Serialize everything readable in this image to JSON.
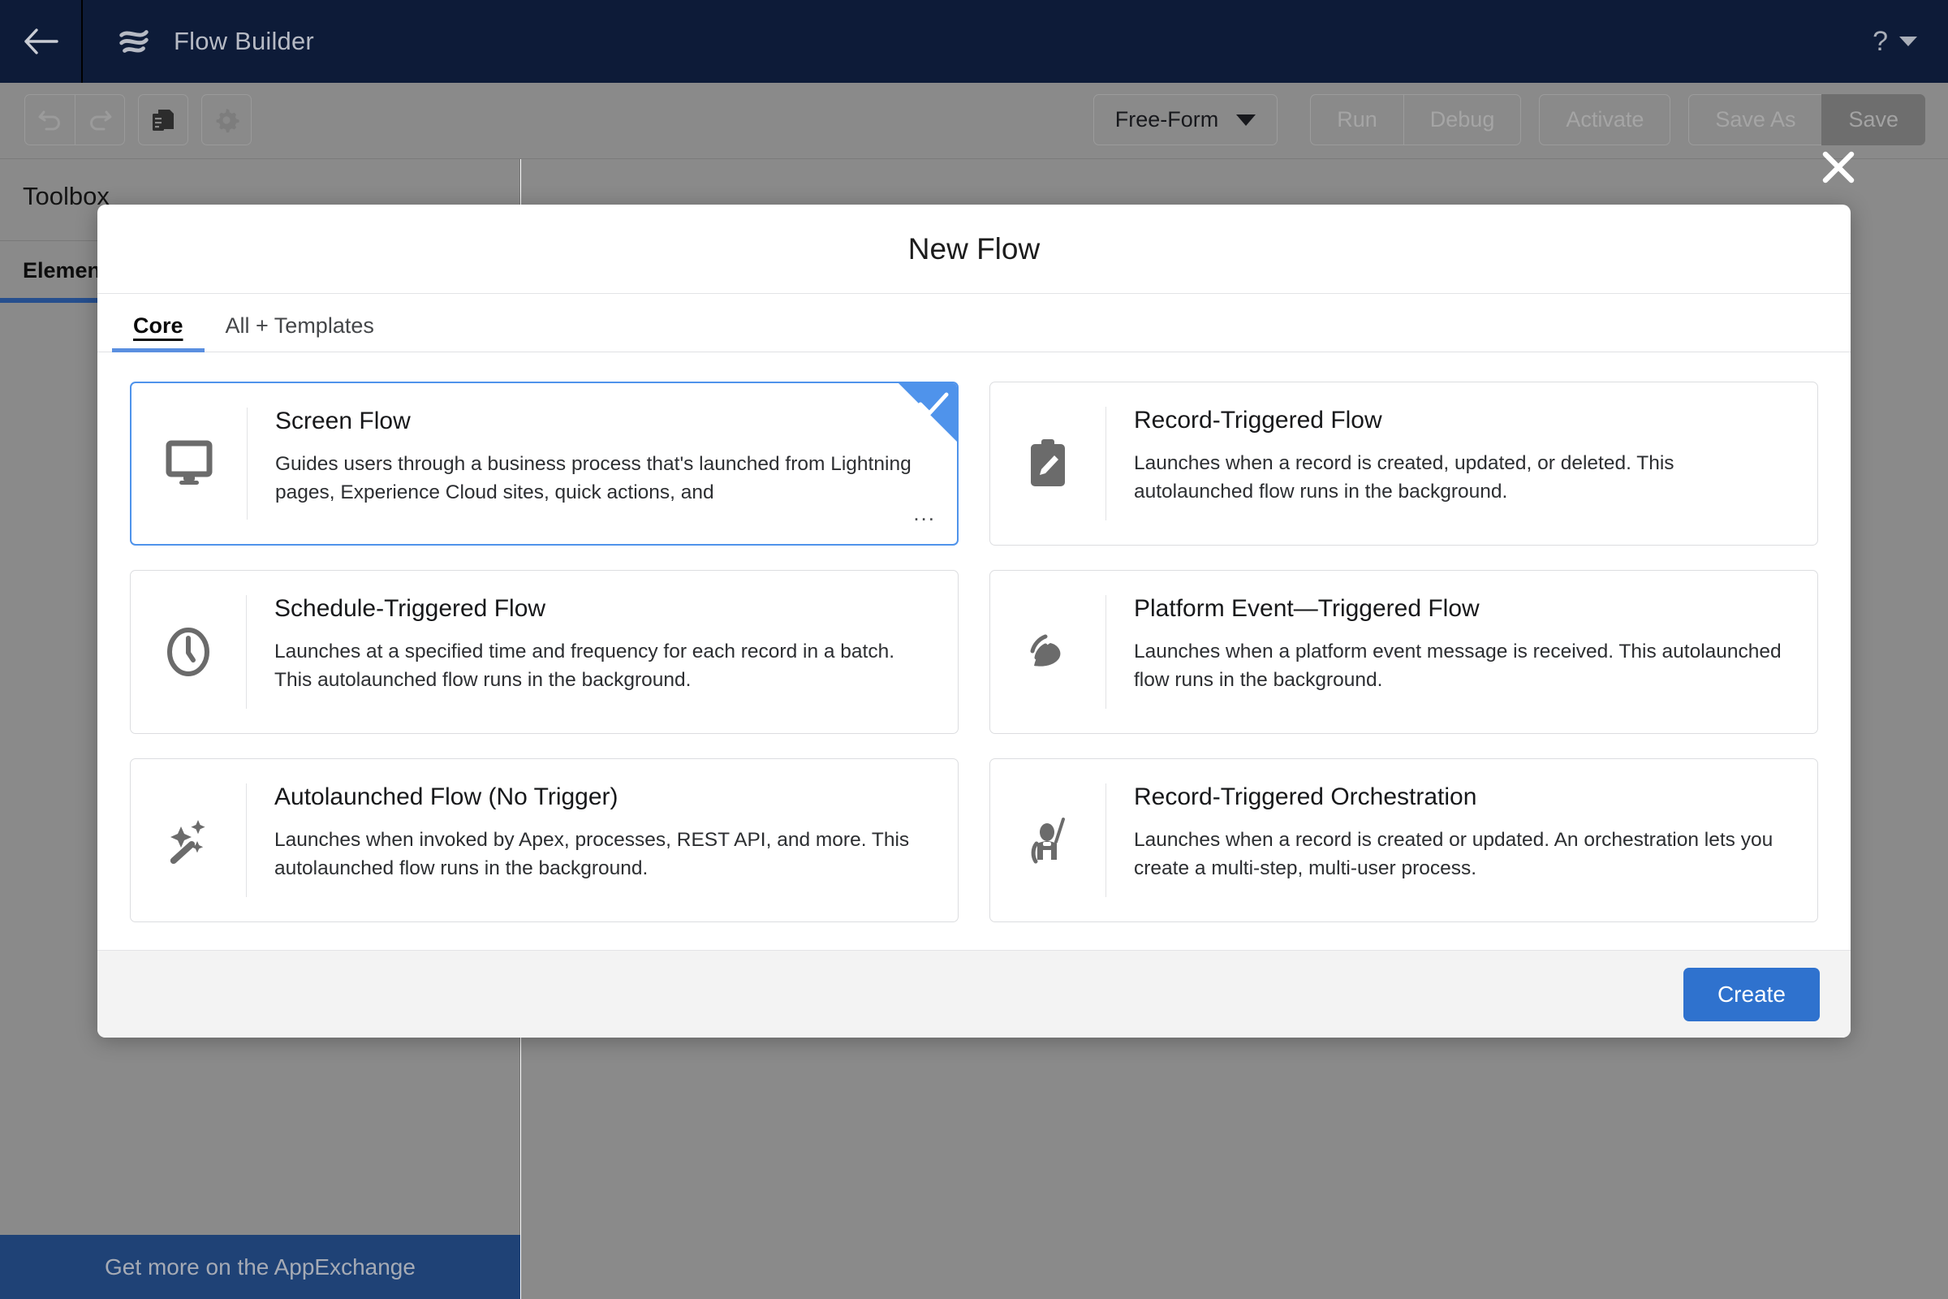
{
  "app": {
    "title": "Flow Builder",
    "back_icon": "back-arrow-icon",
    "logo_icon": "flow-logo-icon",
    "help_icon": "question-mark-icon",
    "help_caret_icon": "chevron-down-icon"
  },
  "toolbar": {
    "undo_icon": "undo-icon",
    "redo_icon": "redo-icon",
    "copy_icon": "copy-icon",
    "settings_icon": "gear-icon",
    "layout_select": {
      "value": "Free-Form",
      "caret_icon": "chevron-down-icon"
    },
    "actions": [
      {
        "label": "Run",
        "disabled": true
      },
      {
        "label": "Debug",
        "disabled": true
      },
      {
        "label": "Activate",
        "disabled": true
      },
      {
        "label": "Save As",
        "disabled": true
      },
      {
        "label": "Save",
        "disabled": true,
        "primary": true
      }
    ]
  },
  "sidebar": {
    "title": "Toolbox",
    "tabs": [
      {
        "label": "Elements",
        "active": true
      }
    ],
    "appexchange_label": "Get more on the AppExchange"
  },
  "modal": {
    "title": "New Flow",
    "close_icon": "close-icon",
    "tabs": [
      {
        "label": "Core",
        "active": true
      },
      {
        "label": "All + Templates",
        "active": false
      }
    ],
    "cards": [
      {
        "id": "screen-flow",
        "title": "Screen Flow",
        "description": "Guides users through a business process that's launched from Lightning pages, Experience Cloud sites, quick actions, and",
        "ellipsis": "...",
        "icon": "monitor-icon",
        "selected": true
      },
      {
        "id": "record-triggered-flow",
        "title": "Record-Triggered Flow",
        "description": "Launches when a record is created, updated, or deleted. This autolaunched flow runs in the background.",
        "ellipsis": "",
        "icon": "clipboard-pencil-icon",
        "selected": false
      },
      {
        "id": "schedule-triggered-flow",
        "title": "Schedule-Triggered Flow",
        "description": "Launches at a specified time and frequency for each record in a batch. This autolaunched flow runs in the background.",
        "ellipsis": "",
        "icon": "clock-icon",
        "selected": false
      },
      {
        "id": "platform-event-triggered-flow",
        "title": "Platform Event—Triggered Flow",
        "description": "Launches when a platform event message is received. This autolaunched flow runs in the background.",
        "ellipsis": "",
        "icon": "broadcast-icon",
        "selected": false
      },
      {
        "id": "autolaunched-flow",
        "title": "Autolaunched Flow (No Trigger)",
        "description": "Launches when invoked by Apex, processes, REST API, and more. This autolaunched flow runs in the background.",
        "ellipsis": "",
        "icon": "magic-wand-icon",
        "selected": false
      },
      {
        "id": "record-triggered-orchestration",
        "title": "Record-Triggered Orchestration",
        "description": "Launches when a record is created or updated. An orchestration lets you create a multi-step, multi-user process.",
        "ellipsis": "",
        "icon": "orchestration-icon",
        "selected": false
      }
    ],
    "footer": {
      "create_label": "Create"
    }
  },
  "colors": {
    "header_bg": "#0d1b38",
    "toolbar_bg": "#8a8a8a",
    "accent_blue": "#4f93eb",
    "primary_button": "#2f72ce",
    "appexchange_bg": "#1f4276",
    "sidebar_tab_underline": "#264f8e"
  }
}
